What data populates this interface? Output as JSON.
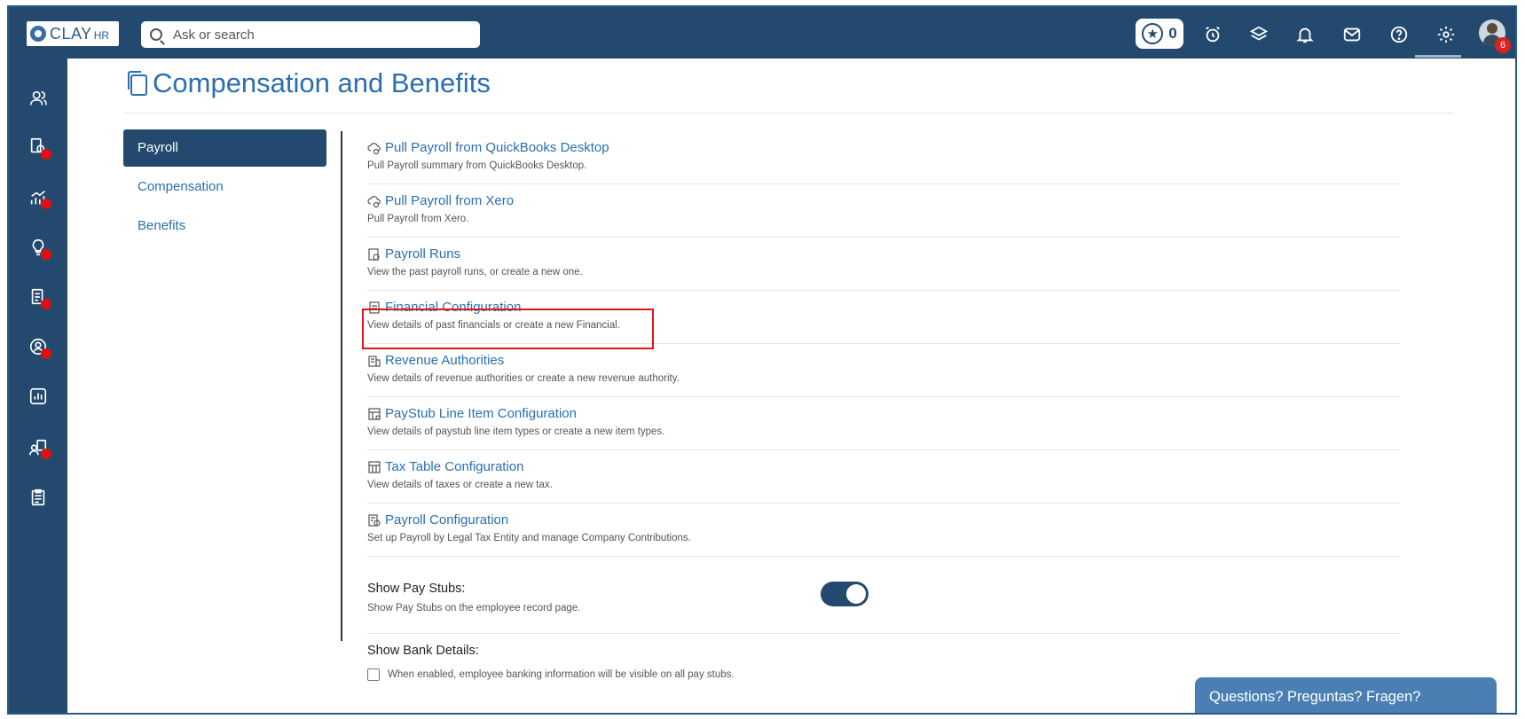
{
  "app": {
    "logo_text": "CLAY",
    "logo_sub": "HR",
    "search_placeholder": "Ask or search"
  },
  "topbar": {
    "points": "0",
    "avatar_badge": "6",
    "icons": [
      "star-icon",
      "alarm-clock-icon",
      "layers-icon",
      "bell-icon",
      "mail-icon",
      "help-icon",
      "gear-icon",
      "avatar"
    ]
  },
  "rail": {
    "items": [
      {
        "name": "people-icon",
        "dot": false
      },
      {
        "name": "hiring-icon",
        "dot": true
      },
      {
        "name": "performance-icon",
        "dot": true
      },
      {
        "name": "ideas-icon",
        "dot": true
      },
      {
        "name": "documents-icon",
        "dot": true
      },
      {
        "name": "profile-icon",
        "dot": true
      },
      {
        "name": "reports-icon",
        "dot": false
      },
      {
        "name": "support-icon",
        "dot": true
      },
      {
        "name": "checklist-icon",
        "dot": false
      }
    ]
  },
  "page": {
    "title": "Compensation and Benefits"
  },
  "subnav": {
    "items": [
      "Payroll",
      "Compensation",
      "Benefits"
    ],
    "active": "Payroll"
  },
  "list": [
    {
      "title": "Pull Payroll from QuickBooks Desktop",
      "desc": "Pull Payroll summary from QuickBooks Desktop.",
      "icon": "cloud-sync-icon"
    },
    {
      "title": "Pull Payroll from Xero",
      "desc": "Pull Payroll from Xero.",
      "icon": "cloud-sync-icon"
    },
    {
      "title": "Payroll Runs",
      "desc": "View the past payroll runs, or create a new one.",
      "icon": "payroll-runs-icon"
    },
    {
      "title": "Financial Configuration",
      "desc": "View details of past financials or create a new Financial.",
      "icon": "document-icon"
    },
    {
      "title": "Revenue Authorities",
      "desc": "View details of revenue authorities or create a new revenue authority.",
      "icon": "building-icon"
    },
    {
      "title": "PayStub Line Item Configuration",
      "desc": "View details of paystub line item types or create a new item types.",
      "icon": "table-settings-icon"
    },
    {
      "title": "Tax Table Configuration",
      "desc": "View details of taxes or create a new tax.",
      "icon": "table-icon"
    },
    {
      "title": "Payroll Configuration",
      "desc": "Set up Payroll by Legal Tax Entity and manage Company Contributions.",
      "icon": "payroll-config-icon"
    }
  ],
  "settings": {
    "show_pay_stubs": {
      "label": "Show Pay Stubs:",
      "desc": "Show Pay Stubs on the employee record page.",
      "enabled": true
    },
    "show_bank_details": {
      "label": "Show Bank Details:",
      "checkbox_label": "When enabled, employee banking information will be visible on all pay stubs.",
      "checked": false
    }
  },
  "help": {
    "label": "Questions? Preguntas? Fragen?"
  },
  "colors": {
    "nav": "#234a6e",
    "link": "#2a6fb0",
    "highlight": "#e0141b",
    "dot": "#e01010"
  }
}
